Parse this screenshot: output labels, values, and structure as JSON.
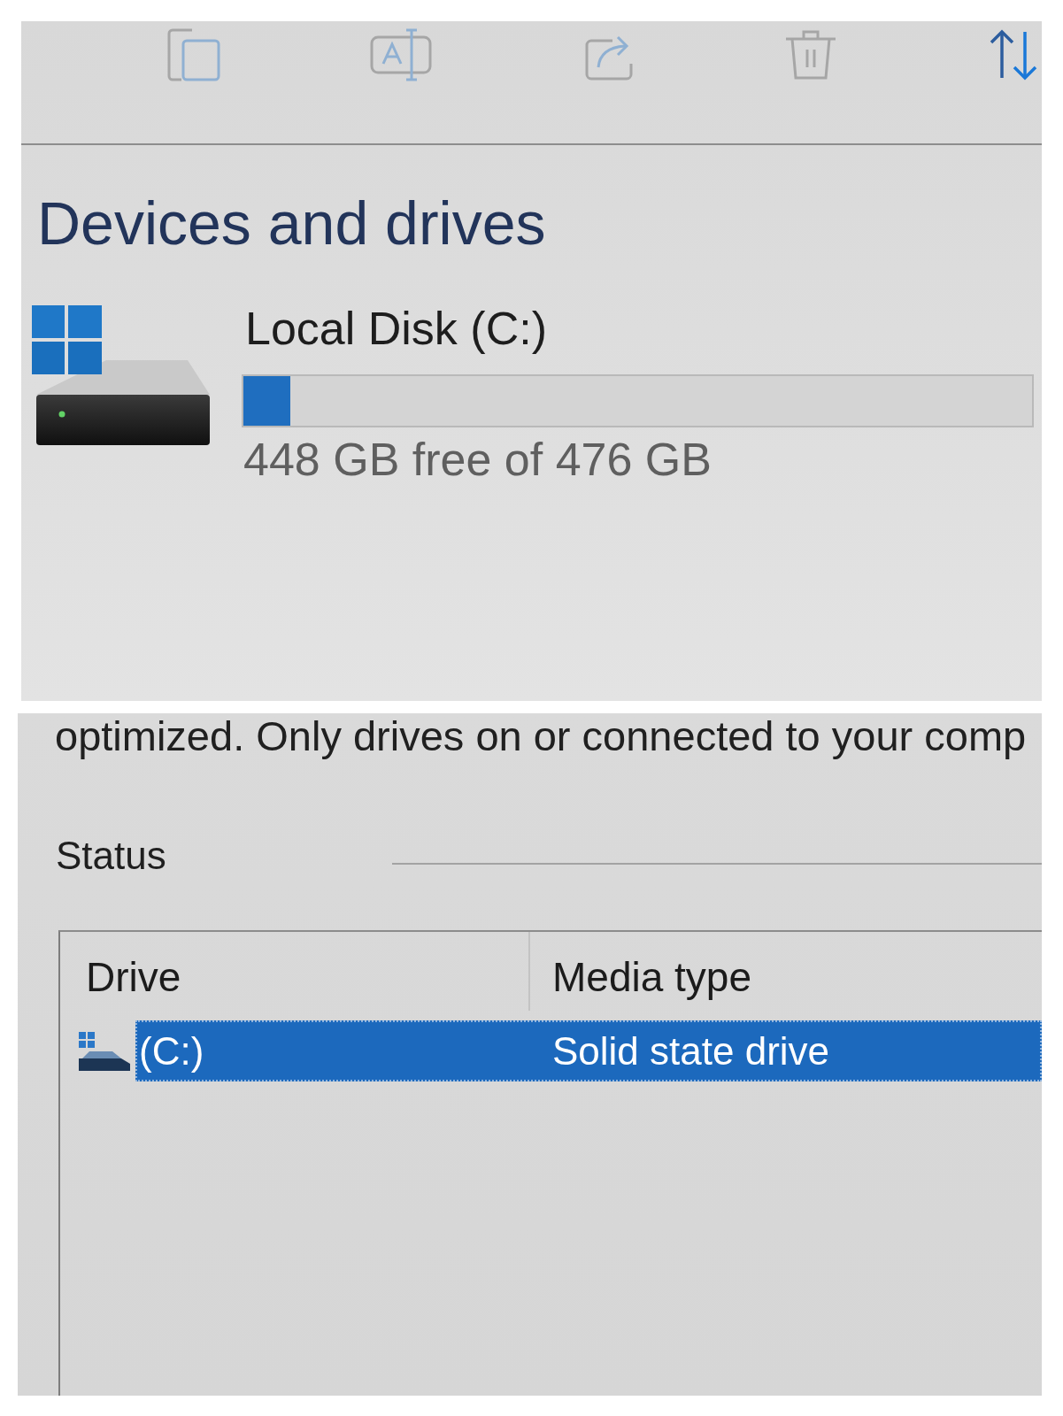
{
  "explorer": {
    "toolbar": [
      {
        "kind": "copy",
        "disabled": true
      },
      {
        "kind": "rename",
        "disabled": true
      },
      {
        "kind": "share",
        "disabled": true
      },
      {
        "kind": "delete",
        "disabled": true
      },
      {
        "kind": "sort",
        "disabled": false
      }
    ],
    "section_title": "Devices and drives",
    "drives": [
      {
        "name": "Local Disk (C:)",
        "level": 0.06,
        "free_space": "448 GB free of 476 GB"
      }
    ]
  },
  "optimize_drives": {
    "description": "optimized. Only drives on or connected to your comp",
    "status_label": "Status",
    "table": {
      "columns": [
        "Drive",
        "Media type"
      ],
      "rows": [
        {
          "drive": "(C:)",
          "media_type": "Solid state drive",
          "selected": true
        }
      ]
    }
  }
}
